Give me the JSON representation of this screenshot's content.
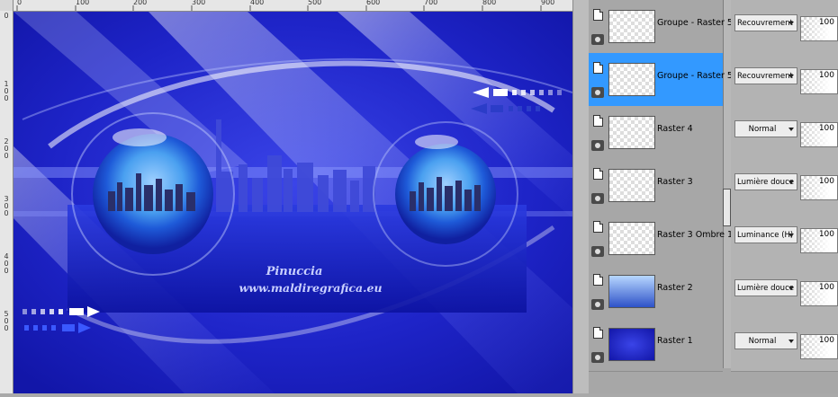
{
  "rulers": {
    "top_labels": [
      "0",
      "100",
      "200",
      "300",
      "400",
      "500",
      "600",
      "700",
      "800",
      "900"
    ],
    "left_labels": [
      "0",
      "1\n0\n0",
      "2\n0\n0",
      "3\n0\n0",
      "4\n0\n0",
      "5\n0\n0"
    ]
  },
  "canvas": {
    "watermark_line1": "Pinuccia",
    "watermark_line2": "www.maldiregrafica.eu",
    "colors": {
      "deep_blue": "#1a1fc0",
      "mid_blue": "#3a44e0",
      "light": "#c8d0ff"
    }
  },
  "layers": [
    {
      "name": "Groupe - Raster 5",
      "blend": "Recouvrement",
      "opacity": "100",
      "selected": false
    },
    {
      "name": "Groupe - Raster 5",
      "blend": "Recouvrement",
      "opacity": "100",
      "selected": true
    },
    {
      "name": "Raster 4",
      "blend": "Normal",
      "opacity": "100",
      "selected": false
    },
    {
      "name": "Raster 3",
      "blend": "Lumière douce",
      "opacity": "100",
      "selected": false
    },
    {
      "name": "Raster 3 Ombre 1",
      "blend": "Luminance (H)",
      "opacity": "100",
      "selected": false
    },
    {
      "name": "Raster 2",
      "blend": "Lumière douce",
      "opacity": "100",
      "selected": false
    },
    {
      "name": "Raster 1",
      "blend": "Normal",
      "opacity": "100",
      "selected": false
    }
  ],
  "icons": {
    "layer_doc": "document-icon",
    "visibility": "eye-icon",
    "dropdown": "chevron-down-icon"
  },
  "selection_color": "#3399ff"
}
